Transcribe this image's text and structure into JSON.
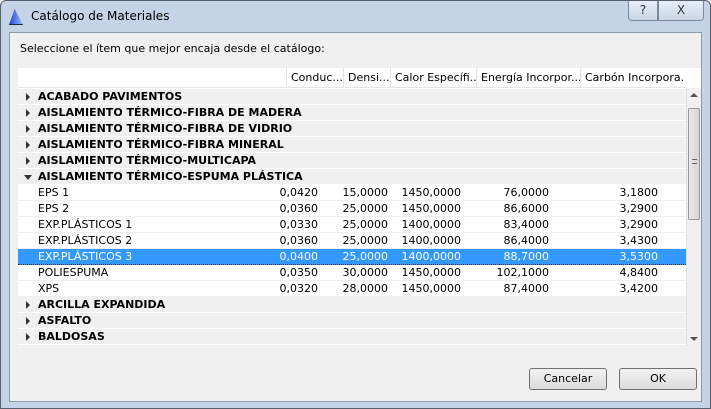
{
  "window": {
    "title": "Catálogo de Materiales",
    "help": "?",
    "close": "X"
  },
  "prompt": "Seleccione el ítem que mejor encaja desde el catálogo:",
  "columns": [
    "",
    "Conduc...",
    "Densi...",
    "Calor Específi...",
    "Energía Incorpor...",
    "Carbón Incorpora..."
  ],
  "groups_before": [
    "ACABADO PAVIMENTOS",
    "AISLAMIENTO TÉRMICO-FIBRA DE MADERA",
    "AISLAMIENTO TÉRMICO-FIBRA DE VIDRIO",
    "AISLAMIENTO TÉRMICO-FIBRA MINERAL",
    "AISLAMIENTO TÉRMICO-MULTICAPA"
  ],
  "open_group": "AISLAMIENTO TÉRMICO-ESPUMA PLÁSTICA",
  "items": [
    {
      "name": "EPS 1",
      "v": [
        "0,0420",
        "15,0000",
        "1450,0000",
        "76,0000",
        "3,1800"
      ]
    },
    {
      "name": "EPS 2",
      "v": [
        "0,0360",
        "25,0000",
        "1450,0000",
        "86,6000",
        "3,2900"
      ]
    },
    {
      "name": "EXP.PLÁSTICOS 1",
      "v": [
        "0,0330",
        "25,0000",
        "1400,0000",
        "83,4000",
        "3,2900"
      ]
    },
    {
      "name": "EXP.PLÁSTICOS 2",
      "v": [
        "0,0360",
        "25,0000",
        "1400,0000",
        "86,4000",
        "3,4300"
      ]
    },
    {
      "name": "EXP.PLÁSTICOS 3",
      "v": [
        "0,0400",
        "25,0000",
        "1400,0000",
        "88,7000",
        "3,5300"
      ],
      "selected": true
    },
    {
      "name": "POLIESPUMA",
      "v": [
        "0,0350",
        "30,0000",
        "1450,0000",
        "102,1000",
        "4,8400"
      ]
    },
    {
      "name": "XPS",
      "v": [
        "0,0320",
        "28,0000",
        "1450,0000",
        "87,4000",
        "3,4200"
      ]
    }
  ],
  "groups_after": [
    "ARCILLA EXPANDIDA",
    "ASFALTO",
    "BALDOSAS"
  ],
  "buttons": {
    "cancel": "Cancelar",
    "ok": "OK"
  }
}
